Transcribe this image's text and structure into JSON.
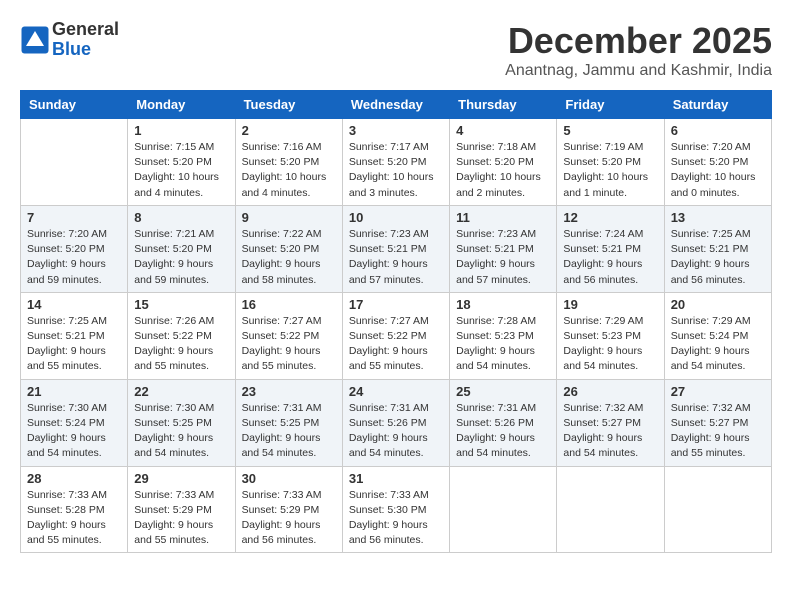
{
  "logo": {
    "general": "General",
    "blue": "Blue"
  },
  "title": "December 2025",
  "subtitle": "Anantnag, Jammu and Kashmir, India",
  "headers": [
    "Sunday",
    "Monday",
    "Tuesday",
    "Wednesday",
    "Thursday",
    "Friday",
    "Saturday"
  ],
  "weeks": [
    [
      {
        "day": "",
        "info": ""
      },
      {
        "day": "1",
        "info": "Sunrise: 7:15 AM\nSunset: 5:20 PM\nDaylight: 10 hours\nand 4 minutes."
      },
      {
        "day": "2",
        "info": "Sunrise: 7:16 AM\nSunset: 5:20 PM\nDaylight: 10 hours\nand 4 minutes."
      },
      {
        "day": "3",
        "info": "Sunrise: 7:17 AM\nSunset: 5:20 PM\nDaylight: 10 hours\nand 3 minutes."
      },
      {
        "day": "4",
        "info": "Sunrise: 7:18 AM\nSunset: 5:20 PM\nDaylight: 10 hours\nand 2 minutes."
      },
      {
        "day": "5",
        "info": "Sunrise: 7:19 AM\nSunset: 5:20 PM\nDaylight: 10 hours\nand 1 minute."
      },
      {
        "day": "6",
        "info": "Sunrise: 7:20 AM\nSunset: 5:20 PM\nDaylight: 10 hours\nand 0 minutes."
      }
    ],
    [
      {
        "day": "7",
        "info": "Sunrise: 7:20 AM\nSunset: 5:20 PM\nDaylight: 9 hours\nand 59 minutes."
      },
      {
        "day": "8",
        "info": "Sunrise: 7:21 AM\nSunset: 5:20 PM\nDaylight: 9 hours\nand 59 minutes."
      },
      {
        "day": "9",
        "info": "Sunrise: 7:22 AM\nSunset: 5:20 PM\nDaylight: 9 hours\nand 58 minutes."
      },
      {
        "day": "10",
        "info": "Sunrise: 7:23 AM\nSunset: 5:21 PM\nDaylight: 9 hours\nand 57 minutes."
      },
      {
        "day": "11",
        "info": "Sunrise: 7:23 AM\nSunset: 5:21 PM\nDaylight: 9 hours\nand 57 minutes."
      },
      {
        "day": "12",
        "info": "Sunrise: 7:24 AM\nSunset: 5:21 PM\nDaylight: 9 hours\nand 56 minutes."
      },
      {
        "day": "13",
        "info": "Sunrise: 7:25 AM\nSunset: 5:21 PM\nDaylight: 9 hours\nand 56 minutes."
      }
    ],
    [
      {
        "day": "14",
        "info": "Sunrise: 7:25 AM\nSunset: 5:21 PM\nDaylight: 9 hours\nand 55 minutes."
      },
      {
        "day": "15",
        "info": "Sunrise: 7:26 AM\nSunset: 5:22 PM\nDaylight: 9 hours\nand 55 minutes."
      },
      {
        "day": "16",
        "info": "Sunrise: 7:27 AM\nSunset: 5:22 PM\nDaylight: 9 hours\nand 55 minutes."
      },
      {
        "day": "17",
        "info": "Sunrise: 7:27 AM\nSunset: 5:22 PM\nDaylight: 9 hours\nand 55 minutes."
      },
      {
        "day": "18",
        "info": "Sunrise: 7:28 AM\nSunset: 5:23 PM\nDaylight: 9 hours\nand 54 minutes."
      },
      {
        "day": "19",
        "info": "Sunrise: 7:29 AM\nSunset: 5:23 PM\nDaylight: 9 hours\nand 54 minutes."
      },
      {
        "day": "20",
        "info": "Sunrise: 7:29 AM\nSunset: 5:24 PM\nDaylight: 9 hours\nand 54 minutes."
      }
    ],
    [
      {
        "day": "21",
        "info": "Sunrise: 7:30 AM\nSunset: 5:24 PM\nDaylight: 9 hours\nand 54 minutes."
      },
      {
        "day": "22",
        "info": "Sunrise: 7:30 AM\nSunset: 5:25 PM\nDaylight: 9 hours\nand 54 minutes."
      },
      {
        "day": "23",
        "info": "Sunrise: 7:31 AM\nSunset: 5:25 PM\nDaylight: 9 hours\nand 54 minutes."
      },
      {
        "day": "24",
        "info": "Sunrise: 7:31 AM\nSunset: 5:26 PM\nDaylight: 9 hours\nand 54 minutes."
      },
      {
        "day": "25",
        "info": "Sunrise: 7:31 AM\nSunset: 5:26 PM\nDaylight: 9 hours\nand 54 minutes."
      },
      {
        "day": "26",
        "info": "Sunrise: 7:32 AM\nSunset: 5:27 PM\nDaylight: 9 hours\nand 54 minutes."
      },
      {
        "day": "27",
        "info": "Sunrise: 7:32 AM\nSunset: 5:27 PM\nDaylight: 9 hours\nand 55 minutes."
      }
    ],
    [
      {
        "day": "28",
        "info": "Sunrise: 7:33 AM\nSunset: 5:28 PM\nDaylight: 9 hours\nand 55 minutes."
      },
      {
        "day": "29",
        "info": "Sunrise: 7:33 AM\nSunset: 5:29 PM\nDaylight: 9 hours\nand 55 minutes."
      },
      {
        "day": "30",
        "info": "Sunrise: 7:33 AM\nSunset: 5:29 PM\nDaylight: 9 hours\nand 56 minutes."
      },
      {
        "day": "31",
        "info": "Sunrise: 7:33 AM\nSunset: 5:30 PM\nDaylight: 9 hours\nand 56 minutes."
      },
      {
        "day": "",
        "info": ""
      },
      {
        "day": "",
        "info": ""
      },
      {
        "day": "",
        "info": ""
      }
    ]
  ]
}
